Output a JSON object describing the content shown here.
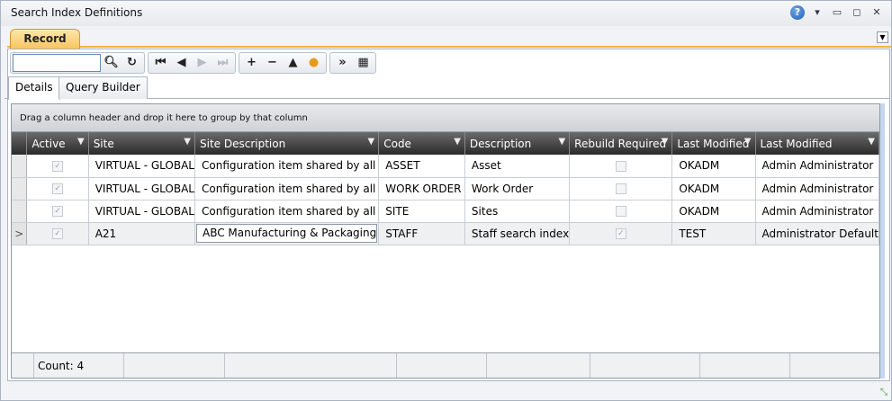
{
  "window": {
    "title": "Search Index Definitions"
  },
  "tabs": {
    "record": "Record"
  },
  "toolbar": {
    "search_value": ""
  },
  "subtabs": [
    "Details",
    "Query Builder"
  ],
  "grid": {
    "group_hint": "Drag a column header and drop it here to group by that column",
    "columns": [
      "Active",
      "Site",
      "Site Description",
      "Code",
      "Description",
      "Rebuild Required",
      "Last Modified",
      "Last Modified"
    ],
    "rows": [
      {
        "active": true,
        "site": "VIRTUAL - GLOBAL",
        "site_desc": "Configuration item shared by all",
        "code": "ASSET",
        "desc": "Asset",
        "rebuild": false,
        "lm_by": "OKADM",
        "lm_name": "Admin Administrator"
      },
      {
        "active": true,
        "site": "VIRTUAL - GLOBAL",
        "site_desc": "Configuration item shared by all",
        "code": "WORK ORDER",
        "desc": "Work Order",
        "rebuild": false,
        "lm_by": "OKADM",
        "lm_name": "Admin Administrator"
      },
      {
        "active": true,
        "site": "VIRTUAL - GLOBAL",
        "site_desc": "Configuration item shared by all",
        "code": "SITE",
        "desc": "Sites",
        "rebuild": false,
        "lm_by": "OKADM",
        "lm_name": "Admin Administrator"
      },
      {
        "active": true,
        "site": "A21",
        "site_desc": "ABC Manufacturing & Packaging",
        "code": "STAFF",
        "desc": "Staff search index",
        "rebuild": true,
        "lm_by": "TEST",
        "lm_name": "Administrator Default"
      }
    ],
    "count_label": "Count: 4",
    "current_row_marker": ">"
  }
}
